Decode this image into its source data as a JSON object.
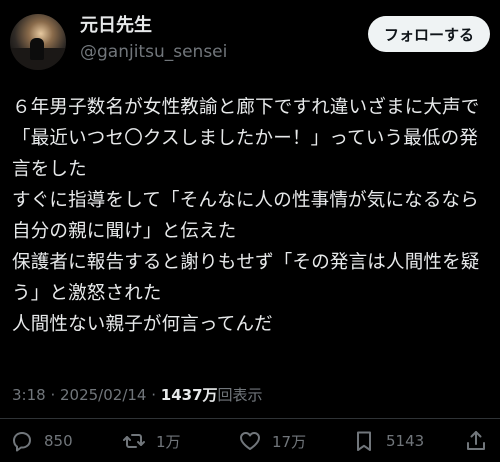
{
  "author": {
    "display_name": "元日先生",
    "handle": "@ganjitsu_sensei"
  },
  "follow_button": {
    "label": "フォローする"
  },
  "tweet": {
    "text": "６年男子数名が女性教諭と廊下ですれ違いざまに大声で「最近いつセ〇クスしましたかー！」っていう最低の発言をした\nすぐに指導をして「そんなに人の性事情が気になるなら自分の親に聞け」と伝えた\n保護者に報告すると謝りもせず「その発言は人間性を疑う」と激怒された\n人間性ない親子が何言ってんだ"
  },
  "meta": {
    "time": "3:18",
    "separator": " · ",
    "date": "2025/02/14",
    "separator2": " · ",
    "views_count": "1437万",
    "views_label": "回表示"
  },
  "actions": {
    "reply": {
      "icon": "reply-icon",
      "count": "850"
    },
    "repost": {
      "icon": "repost-icon",
      "count": "1万"
    },
    "like": {
      "icon": "heart-icon",
      "count": "17万"
    },
    "bookmark": {
      "icon": "bookmark-icon",
      "count": "5143"
    },
    "share": {
      "icon": "share-icon"
    }
  },
  "colors": {
    "background": "#000000",
    "text_primary": "#e7e9ea",
    "text_secondary": "#71767b",
    "follow_button_bg": "#eff3f4",
    "divider": "#2f3336"
  }
}
